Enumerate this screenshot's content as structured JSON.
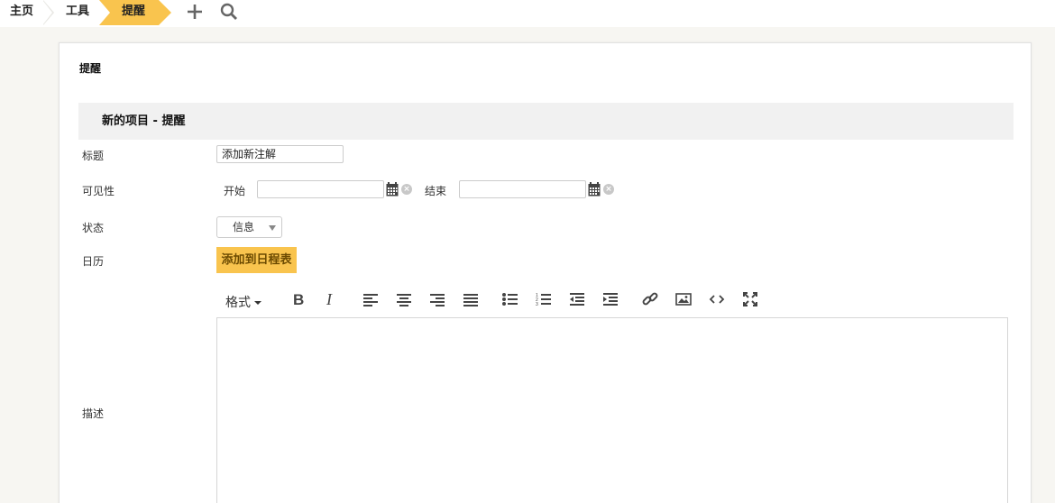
{
  "breadcrumb": {
    "home": "主页",
    "tools": "工具",
    "current": "提醒"
  },
  "topbar": {
    "add_icon": "plus-icon",
    "search_icon": "search-icon"
  },
  "panel": {
    "title": "提醒",
    "section_header": "新的项目 - 提醒"
  },
  "form": {
    "title_label": "标题",
    "title_value": "添加新注解",
    "visibility_label": "可见性",
    "start_label": "开始",
    "start_value": "",
    "end_label": "结束",
    "end_value": "",
    "status_label": "状态",
    "status_value": "信息",
    "calendar_label": "日历",
    "add_to_calendar_button": "添加到日程表",
    "description_label": "描述",
    "description_value": ""
  },
  "editor_toolbar": {
    "format_label": "格式",
    "buttons": [
      "bold-icon",
      "italic-icon",
      "align-left-icon",
      "align-center-icon",
      "align-right-icon",
      "align-justify-icon",
      "bullet-list-icon",
      "numbered-list-icon",
      "outdent-icon",
      "indent-icon",
      "link-icon",
      "image-icon",
      "code-icon",
      "fullscreen-icon"
    ]
  },
  "colors": {
    "accent": "#f9c44e",
    "background": "#f7f6f2",
    "section_header_bg": "#f1f1f1"
  }
}
